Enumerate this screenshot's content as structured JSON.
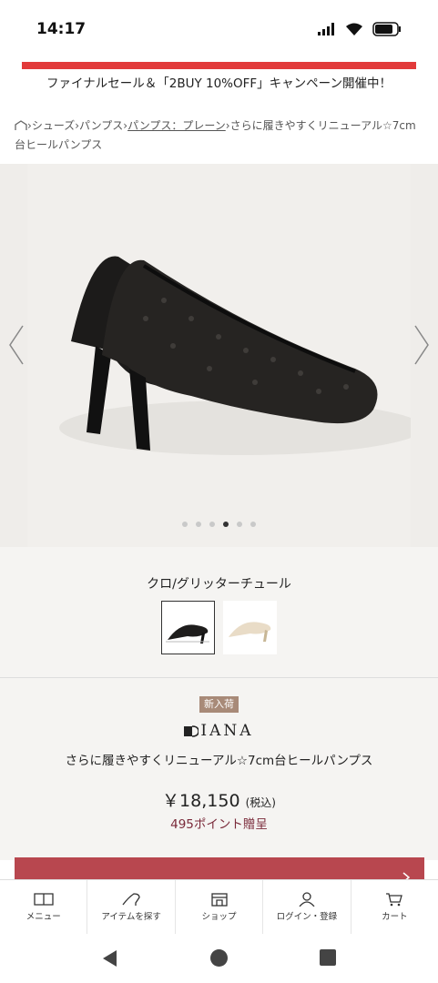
{
  "status_bar": {
    "time": "14:17"
  },
  "banner": {
    "text": "ファイナルセール＆「2BUY 10%OFF」キャンペーン開催中！",
    "accent_color": "#e23a3a"
  },
  "breadcrumb": {
    "items": [
      "シューズ",
      "パンプス",
      "パンプス：プレーン"
    ],
    "current": "さらに履きやすくリニューアル☆7cm台ヒールパンプス"
  },
  "gallery": {
    "dot_count": 6,
    "active_dot": 4
  },
  "color": {
    "name": "クロ/グリッターチュール",
    "swatches": [
      "black-glitter-tulle",
      "beige-tulle"
    ],
    "selected": 0
  },
  "product": {
    "badge": "新入荷",
    "brand": "IANA",
    "name": "さらに履きやすくリニューアル☆7cm台ヒールパンプス",
    "price": "￥18,150",
    "tax_note": "(税込)",
    "points": "495ポイント贈呈"
  },
  "cart_button": {
    "color": "#b8474f"
  },
  "bottom_nav": {
    "items": [
      {
        "label": "メニュー",
        "icon": "book-icon"
      },
      {
        "label": "アイテムを探す",
        "icon": "shoe-icon"
      },
      {
        "label": "ショップ",
        "icon": "shop-icon"
      },
      {
        "label": "ログイン・登録",
        "icon": "user-icon"
      },
      {
        "label": "カート",
        "icon": "cart-icon"
      }
    ]
  }
}
